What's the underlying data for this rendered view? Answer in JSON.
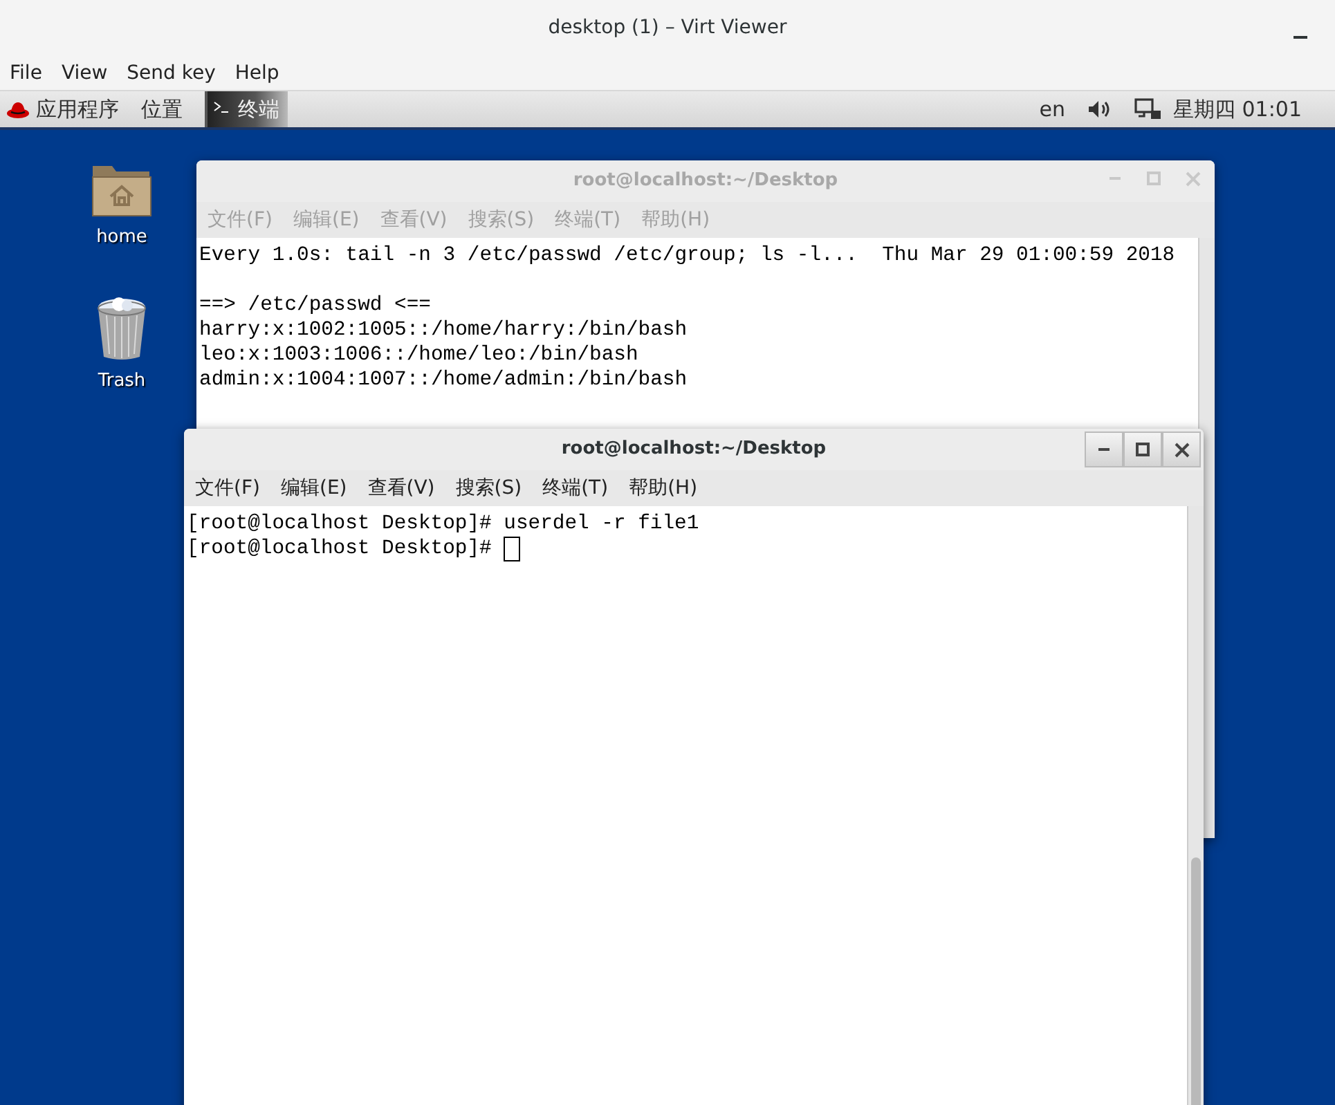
{
  "viewer": {
    "title": "desktop (1) – Virt Viewer",
    "menu": [
      "File",
      "View",
      "Send key",
      "Help"
    ]
  },
  "top_bar": {
    "applications": "应用程序",
    "places": "位置",
    "task": "终端",
    "language": "en",
    "clock": "星期四 01:01"
  },
  "desktop_icons": [
    {
      "label": "home",
      "kind": "folder"
    },
    {
      "label": "Trash",
      "kind": "trash"
    }
  ],
  "windows": [
    {
      "title": "root@localhost:~/Desktop",
      "focused": false,
      "cursor": false,
      "menu": [
        "文件(F)",
        "编辑(E)",
        "查看(V)",
        "搜索(S)",
        "终端(T)",
        "帮助(H)"
      ],
      "blocks": [
        [
          "Every 1.0s: tail -n 3 /etc/passwd /etc/group; ls -l...  Thu Mar 29 01:00:59 2018"
        ],
        [
          "==> /etc/passwd <==",
          "harry:x:1002:1005::/home/harry:/bin/bash",
          "leo:x:1003:1006::/home/leo:/bin/bash",
          "admin:x:1004:1007::/home/admin:/bin/bash"
        ]
      ]
    },
    {
      "title": "root@localhost:~/Desktop",
      "focused": true,
      "cursor": true,
      "menu": [
        "文件(F)",
        "编辑(E)",
        "查看(V)",
        "搜索(S)",
        "终端(T)",
        "帮助(H)"
      ],
      "blocks": [
        [
          "[root@localhost Desktop]# userdel -r file1",
          "[root@localhost Desktop]# "
        ]
      ]
    }
  ]
}
